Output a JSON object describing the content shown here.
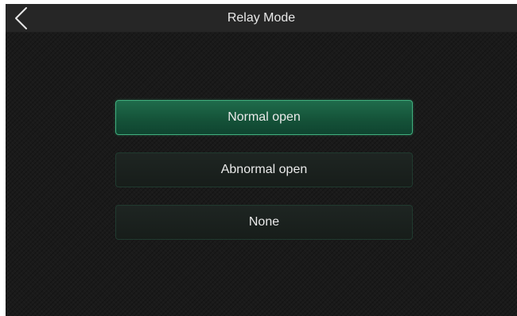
{
  "header": {
    "title": "Relay Mode",
    "back_icon": "chevron-left-icon"
  },
  "options": [
    {
      "label": "Normal open",
      "selected": true
    },
    {
      "label": "Abnormal open",
      "selected": false
    },
    {
      "label": "None",
      "selected": false
    }
  ],
  "colors": {
    "selected_fill": "#155339",
    "selected_border": "#3fae7d",
    "background": "#1a1a1a",
    "titlebar": "#262626",
    "text": "#eaeaea"
  }
}
